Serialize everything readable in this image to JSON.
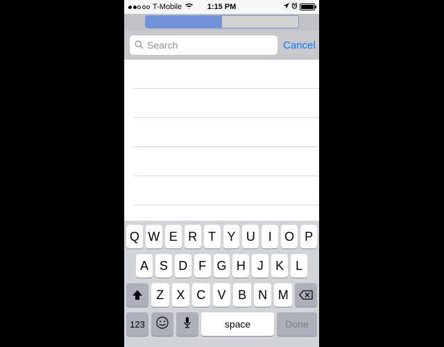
{
  "status": {
    "carrier": "T-Mobile",
    "time": "1:15 PM"
  },
  "segmented": {
    "left_label": "",
    "right_label": ""
  },
  "search": {
    "placeholder": "Search",
    "value": "",
    "cancel_label": "Cancel"
  },
  "keyboard": {
    "row1": [
      "Q",
      "W",
      "E",
      "R",
      "T",
      "Y",
      "U",
      "I",
      "O",
      "P"
    ],
    "row2": [
      "A",
      "S",
      "D",
      "F",
      "G",
      "H",
      "J",
      "K",
      "L"
    ],
    "row3": [
      "Z",
      "X",
      "C",
      "V",
      "B",
      "N",
      "M"
    ],
    "numbers_label": "123",
    "space_label": "space",
    "done_label": "Done"
  }
}
